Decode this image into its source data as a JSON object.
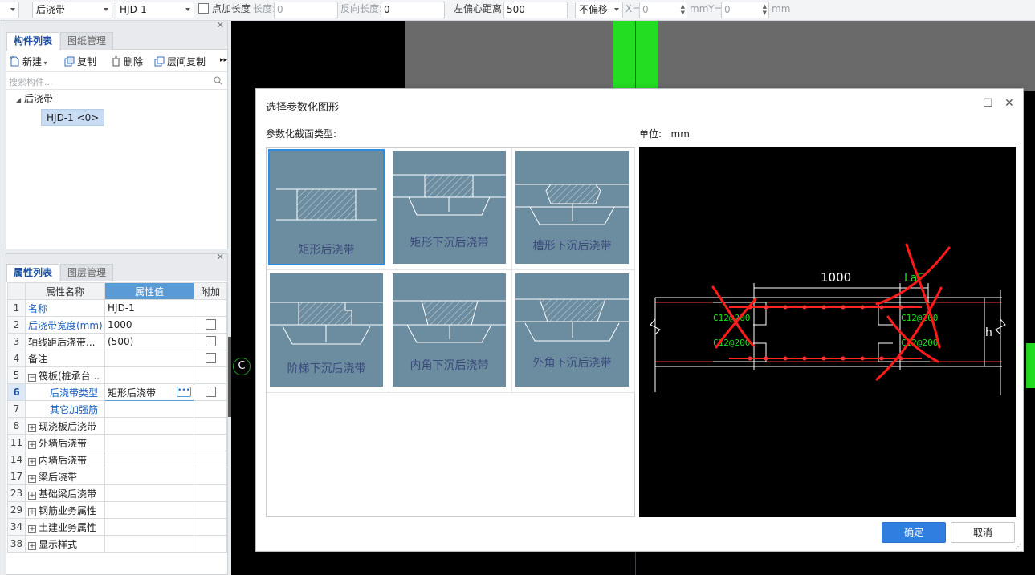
{
  "toolbar": {
    "type_select": "后浇带",
    "name_select": "HJD-1",
    "point_length_label": "点加长度",
    "length_label": "长度:",
    "length_value": "0",
    "reverse_length_label": "反向长度:",
    "reverse_length_value": "0",
    "left_offset_label": "左偏心距离:",
    "left_offset_value": "500",
    "offset_select": "不偏移",
    "x_label": "X=",
    "x_value": "0",
    "mm1": "mm",
    "y_label": "Y=",
    "y_value": "0",
    "mm2": "mm"
  },
  "component_panel": {
    "tabs": [
      "构件列表",
      "图纸管理"
    ],
    "commands": {
      "new": "新建",
      "copy": "复制",
      "delete": "删除",
      "floor_copy": "层间复制"
    },
    "search_placeholder": "搜索构件...",
    "tree_root": "后浇带",
    "tree_child": "HJD-1 <0>"
  },
  "property_panel": {
    "tabs": [
      "属性列表",
      "图层管理"
    ],
    "headers": {
      "name": "属性名称",
      "value": "属性值",
      "add": "附加"
    },
    "rows": [
      {
        "num": "1",
        "name": "名称",
        "value": "HJD-1"
      },
      {
        "num": "2",
        "name": "后浇带宽度(mm)",
        "value": "1000"
      },
      {
        "num": "3",
        "name": "轴线距后浇带...",
        "value": "(500)"
      },
      {
        "num": "4",
        "name": "备注",
        "value": ""
      },
      {
        "num": "5",
        "name": "筏板(桩承台...",
        "value": ""
      },
      {
        "num": "6",
        "name": "后浇带类型",
        "value": "矩形后浇带"
      },
      {
        "num": "7",
        "name": "其它加强筋",
        "value": ""
      },
      {
        "num": "8",
        "name": "现浇板后浇带",
        "value": ""
      },
      {
        "num": "11",
        "name": "外墙后浇带",
        "value": ""
      },
      {
        "num": "14",
        "name": "内墙后浇带",
        "value": ""
      },
      {
        "num": "17",
        "name": "梁后浇带",
        "value": ""
      },
      {
        "num": "23",
        "name": "基础梁后浇带",
        "value": ""
      },
      {
        "num": "29",
        "name": "钢筋业务属性",
        "value": ""
      },
      {
        "num": "34",
        "name": "土建业务属性",
        "value": ""
      },
      {
        "num": "38",
        "name": "显示样式",
        "value": ""
      }
    ]
  },
  "dialog": {
    "title": "选择参数化图形",
    "type_label": "参数化截面类型:",
    "unit_label": "单位:",
    "unit_value": "mm",
    "shapes": [
      "矩形后浇带",
      "矩形下沉后浇带",
      "槽形下沉后浇带",
      "阶梯下沉后浇带",
      "内角下沉后浇带",
      "外角下沉后浇带"
    ],
    "preview": {
      "width_dim": "1000",
      "lae": "LaE",
      "rebar_tl": "C12@200",
      "rebar_bl": "C12@200",
      "rebar_tr": "C12@200",
      "rebar_br": "C12@200",
      "h_label": "h"
    },
    "ok": "确定",
    "cancel": "取消"
  },
  "canvas": {
    "marker": "C"
  },
  "colors": {
    "accent": "#2f7ee0",
    "green_bar": "#22dd22",
    "red_line": "#ff2222",
    "thumb": "#6c8ca0"
  }
}
